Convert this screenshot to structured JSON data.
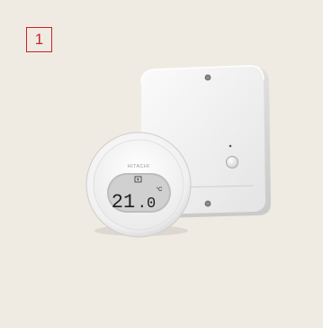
{
  "badge": {
    "number": "1"
  },
  "thermostat": {
    "brand": "HITACHI",
    "temperature_whole": "21",
    "temperature_decimal": ".0",
    "unit": "°C",
    "wireless_icon": "wireless-signal-icon"
  },
  "receiver": {
    "button_icon": "push-button-icon",
    "indicator_icon": "status-led-icon"
  },
  "colors": {
    "background": "#efebe3",
    "badge_accent": "#c8222a",
    "device_white": "#f7f7f7",
    "lcd_gray": "#c9c9c9",
    "lcd_text": "#1e1e1e"
  }
}
